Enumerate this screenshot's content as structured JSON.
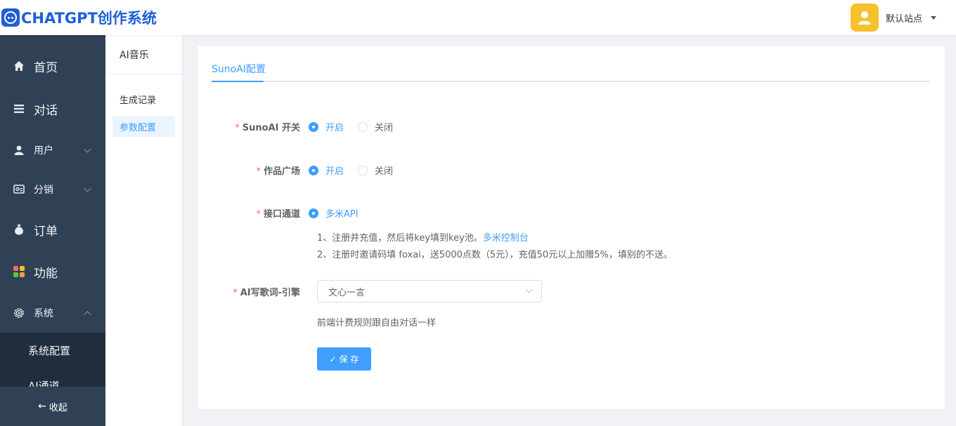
{
  "header": {
    "brand": "CHATGPT创作系统",
    "site_name": "默认站点"
  },
  "sidebar": {
    "items": [
      {
        "label": "首页",
        "icon": "home-icon"
      },
      {
        "label": "对话",
        "icon": "list-icon"
      },
      {
        "label": "用户",
        "icon": "user-icon"
      },
      {
        "label": "分销",
        "icon": "share-icon"
      },
      {
        "label": "订单",
        "icon": "money-bag-icon"
      },
      {
        "label": "功能",
        "icon": "apps-icon"
      },
      {
        "label": "系统",
        "icon": "gear-icon"
      }
    ],
    "system_sub": [
      {
        "label": "系统配置"
      },
      {
        "label": "AI通道"
      }
    ],
    "collapse_label": "收起"
  },
  "subnav": {
    "title": "AI音乐",
    "items": [
      {
        "label": "生成记录"
      },
      {
        "label": "参数配置"
      }
    ]
  },
  "main": {
    "tab": "SunoAI配置",
    "form": {
      "switch_label": "SunoAI 开关",
      "gallery_label": "作品广场",
      "channel_label": "接口通道",
      "engine_label": "AI写歌词-引擎",
      "on": "开启",
      "off": "关闭",
      "channel_option": "多米API",
      "help_line1": "1、注册并充值，然后将key填到key池。",
      "help_link": "多米控制台",
      "help_line2": "2、注册时邀请码填 foxai，送5000点数（5元），充值50元以上加赠5%，填别的不送。",
      "engine_value": "文心一言",
      "engine_hint": "前端计费规则跟自由对话一样",
      "save_label": "保 存"
    }
  },
  "colors": {
    "primary": "#409eff",
    "sidebar_bg": "#304156",
    "brand": "#1f5fd6",
    "required": "#f56c6c"
  }
}
